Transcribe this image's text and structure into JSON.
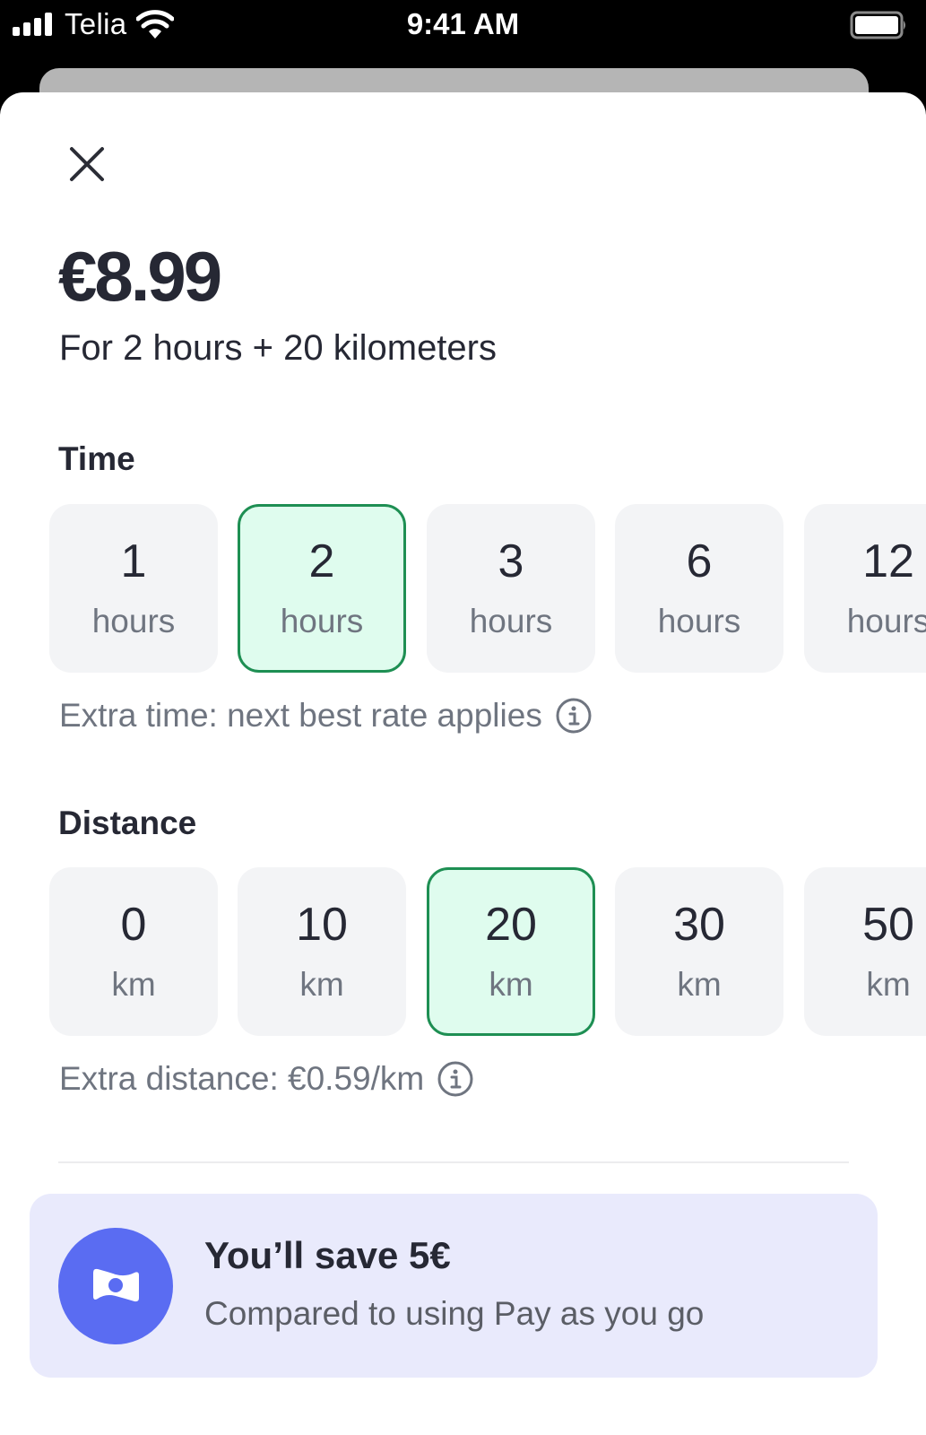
{
  "status_bar": {
    "carrier": "Telia",
    "time": "9:41 AM",
    "signal_icon": "cellular-signal-icon",
    "wifi_icon": "wifi-icon",
    "battery_icon": "battery-icon"
  },
  "header": {
    "close_icon": "close-icon",
    "price": "€8.99",
    "subtitle": "For 2 hours + 20 kilometers"
  },
  "time_section": {
    "title": "Time",
    "options": [
      {
        "value": "1",
        "unit": "hours",
        "selected": false
      },
      {
        "value": "2",
        "unit": "hours",
        "selected": true
      },
      {
        "value": "3",
        "unit": "hours",
        "selected": false
      },
      {
        "value": "6",
        "unit": "hours",
        "selected": false
      },
      {
        "value": "12",
        "unit": "hours",
        "selected": false
      }
    ],
    "note": "Extra time: next best rate applies",
    "note_icon": "info-icon"
  },
  "distance_section": {
    "title": "Distance",
    "options": [
      {
        "value": "0",
        "unit": "km",
        "selected": false
      },
      {
        "value": "10",
        "unit": "km",
        "selected": false
      },
      {
        "value": "20",
        "unit": "km",
        "selected": true
      },
      {
        "value": "30",
        "unit": "km",
        "selected": false
      },
      {
        "value": "50",
        "unit": "km",
        "selected": false
      }
    ],
    "note": "Extra distance: €0.59/km",
    "note_icon": "info-icon"
  },
  "savings": {
    "icon": "money-bill-icon",
    "title": "You’ll save 5€",
    "subtitle": "Compared to using Pay as you go"
  },
  "colors": {
    "selected_bg": "#dffcee",
    "selected_border": "#1e8f53",
    "tile_bg": "#f3f4f6",
    "savings_bg": "#e9eafc",
    "savings_accent": "#5a6cf2",
    "text_primary": "#262834",
    "text_secondary": "#6f7580"
  }
}
